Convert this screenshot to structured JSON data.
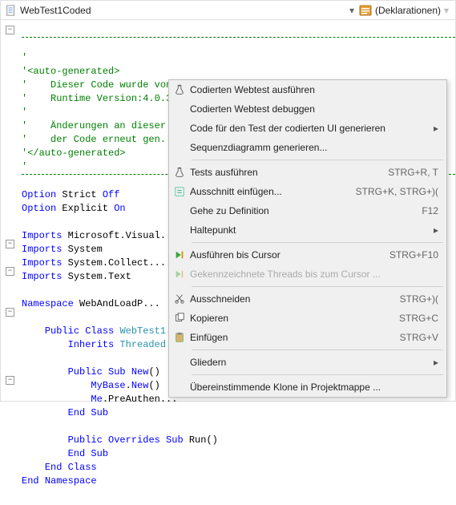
{
  "toolbar": {
    "file_label": "WebTest1Coded",
    "decl_label": "(Deklarationen)"
  },
  "code": {
    "l1": "'",
    "l2": "'<auto-generated>",
    "l3": "'    Dieser Code wurde von einem Tool generiert.",
    "l4": "'    Runtime Version:4.0.30319.17361",
    "l5": "'",
    "l6": "'    Änderungen an dieser ...",
    "l7": "'    der Code erneut gen...",
    "l8": "'</auto-generated>",
    "l9": "'",
    "opt1a": "Option",
    "opt1b": " Strict ",
    "opt1c": "Off",
    "opt2a": "Option",
    "opt2b": " Explicit ",
    "opt2c": "On",
    "imp": "Imports",
    "imp1": " Microsoft.Visual...",
    "imp2": " System",
    "imp3": " System.Collect...",
    "imp4": " System.Text",
    "ns": "Namespace",
    "nsname": " WebAndLoadP...",
    "pub": "Public",
    "cls": "Class",
    "clsname": " WebTest1...",
    "inh": "Inherits",
    "inhname": " Threaded...",
    "sub": "Sub",
    "new": "New",
    "par": "()",
    "mybase": "MyBase",
    "dotnew": ".",
    "newc": "New",
    "me": "Me",
    "preauth": ".PreAuthen...",
    "end": "End",
    "ov": "Overrides",
    "run": " Run()",
    "endcls": "End Class",
    "endns": "End Namespace"
  },
  "menu": {
    "items": [
      {
        "label": "Codierten Webtest ausführen",
        "shortcut": "",
        "icon": "flask",
        "submenu": false,
        "disabled": false
      },
      {
        "label": "Codierten Webtest debuggen",
        "shortcut": "",
        "icon": "",
        "submenu": false,
        "disabled": false
      },
      {
        "label": "Code für den Test der codierten UI generieren",
        "shortcut": "",
        "icon": "",
        "submenu": true,
        "disabled": false
      },
      {
        "label": "Sequenzdiagramm generieren...",
        "shortcut": "",
        "icon": "",
        "submenu": false,
        "disabled": false
      },
      {
        "sep": true
      },
      {
        "label": "Tests ausführen",
        "shortcut": "STRG+R, T",
        "icon": "flask",
        "submenu": false,
        "disabled": false
      },
      {
        "label": "Ausschnitt einfügen...",
        "shortcut": "STRG+K, STRG+)(",
        "icon": "snippet",
        "submenu": false,
        "disabled": false
      },
      {
        "label": "Gehe zu Definition",
        "shortcut": "F12",
        "icon": "",
        "submenu": false,
        "disabled": false
      },
      {
        "label": "Haltepunkt",
        "shortcut": "",
        "icon": "",
        "submenu": true,
        "disabled": false
      },
      {
        "sep": true
      },
      {
        "label": "Ausführen bis Cursor",
        "shortcut": "STRG+F10",
        "icon": "run-to",
        "submenu": false,
        "disabled": false
      },
      {
        "label": "Gekennzeichnete Threads bis zum Cursor ...",
        "shortcut": "",
        "icon": "run-to",
        "submenu": false,
        "disabled": true
      },
      {
        "sep": true
      },
      {
        "label": "Ausschneiden",
        "shortcut": "STRG+)(",
        "icon": "cut",
        "submenu": false,
        "disabled": false
      },
      {
        "label": "Kopieren",
        "shortcut": "STRG+C",
        "icon": "copy",
        "submenu": false,
        "disabled": false
      },
      {
        "label": "Einfügen",
        "shortcut": "STRG+V",
        "icon": "paste",
        "submenu": false,
        "disabled": false
      },
      {
        "sep": true
      },
      {
        "label": "Gliedern",
        "shortcut": "",
        "icon": "",
        "submenu": true,
        "disabled": false
      },
      {
        "sep": true
      },
      {
        "label": "Übereinstimmende Klone in Projektmappe ...",
        "shortcut": "",
        "icon": "",
        "submenu": false,
        "disabled": false
      }
    ]
  }
}
